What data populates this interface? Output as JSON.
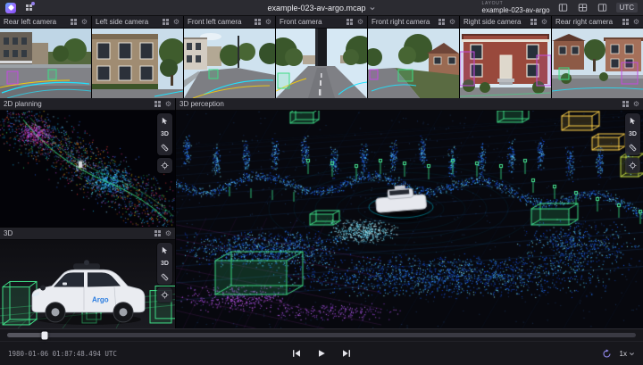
{
  "topbar": {
    "file_menu": {
      "label": "example-023-av-argo.mcap"
    },
    "layout": {
      "eyebrow": "LAYOUT",
      "name": "example-023-av-argo"
    },
    "timezone_button": "UTC"
  },
  "camera_panels": [
    {
      "title": "Rear left camera"
    },
    {
      "title": "Left side camera"
    },
    {
      "title": "Front left camera"
    },
    {
      "title": "Front camera"
    },
    {
      "title": "Front right camera"
    },
    {
      "title": "Right side camera"
    },
    {
      "title": "Rear right camera"
    }
  ],
  "panels": {
    "planning": {
      "title": "2D planning",
      "mode_button": "3D"
    },
    "model": {
      "title": "3D",
      "mode_button": "3D",
      "car_logo": "Argo"
    },
    "perception": {
      "title": "3D perception",
      "mode_button": "3D"
    }
  },
  "playback": {
    "timestamp": "1980-01-06 01:87:48.494 UTC",
    "speed": "1x"
  },
  "colors": {
    "accent_purple": "#9480ed",
    "annotation_green": "#3ddc84",
    "annotation_cyan": "#1fe3ff",
    "annotation_yellow": "#ffd400",
    "annotation_magenta": "#c44ae0",
    "pointcloud_blue": "#2f86f5"
  }
}
